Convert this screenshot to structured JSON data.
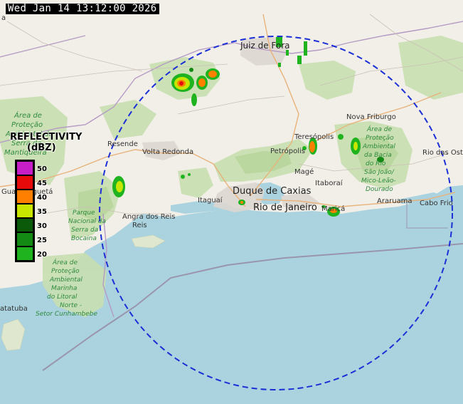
{
  "timestamp": "Wed Jan 14 13:12:00 2026",
  "legend": {
    "title": "REFLECTIVITY",
    "unit": "(dBZ)",
    "levels": [
      {
        "label": "50",
        "color": "#c71ec7"
      },
      {
        "label": "45",
        "color": "#e60a0a"
      },
      {
        "label": "40",
        "color": "#ff8000"
      },
      {
        "label": "35",
        "color": "#c8e600"
      },
      {
        "label": "30",
        "color": "#0a5a0a"
      },
      {
        "label": "25",
        "color": "#138a13"
      },
      {
        "label": "20",
        "color": "#1fb41f"
      }
    ]
  },
  "places": {
    "juiz_de_fora": "Juiz de Fora",
    "nova_friburgo": "Nova Friburgo",
    "teresopolis": "Teresópolis",
    "petropolis": "Petrópolis",
    "volta_redonda": "Volta Redonda",
    "resende": "Resende",
    "mage": "Magé",
    "itaborai": "Itaboraí",
    "duque_de_caxias": "Duque de Caxias",
    "rio_de_janeiro": "Rio de Janeiro",
    "itaguai": "Itaguaí",
    "angra_dos_reis": "Angra dos Reis",
    "ararauama": "Araruama",
    "cabo_frio": "Cabo Frio",
    "rio_das_ostras": "Rio das Ostr",
    "maricá": "Maricá",
    "guaratingueta": "Guaratinguetá",
    "ubatuba": "atatuba",
    "partial_top_left": "a"
  },
  "parks": {
    "serra_mantiqueira": [
      "Área de",
      "Proteção",
      "Ambiental da",
      "Serra da",
      "Mantiqueira"
    ],
    "serra_bocaina": [
      "Parque",
      "Nacional da",
      "Serra da",
      "Bocaina"
    ],
    "macae": [
      "Área de",
      "Proteção",
      "Ambiental",
      "da Bacia",
      "do Rio",
      "São João/",
      "Mico-Leão-",
      "Dourado"
    ],
    "marinha": [
      "Área de",
      "Proteção",
      "Ambiental",
      "Marinha",
      "do Litoral",
      "Norte -",
      "Setor Cunhambebe"
    ]
  },
  "radar": {
    "range_ring": "dashed circle",
    "color": "#1a2fd6"
  }
}
